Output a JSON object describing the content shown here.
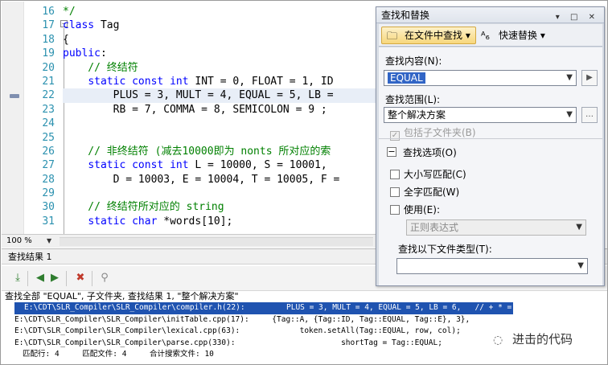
{
  "editor": {
    "zoom": "100 %",
    "lines": [
      {
        "n": "16",
        "parts": [
          {
            "t": "*/",
            "c": "cm"
          }
        ]
      },
      {
        "n": "17",
        "parts": [
          {
            "t": "class",
            "c": "kw"
          },
          {
            "t": " Tag",
            "c": ""
          }
        ]
      },
      {
        "n": "18",
        "parts": [
          {
            "t": "{",
            "c": ""
          }
        ]
      },
      {
        "n": "19",
        "parts": [
          {
            "t": "public",
            "c": "kw"
          },
          {
            "t": ":",
            "c": ""
          }
        ]
      },
      {
        "n": "20",
        "parts": [
          {
            "t": "    // 终结符",
            "c": "cm"
          }
        ]
      },
      {
        "n": "21",
        "parts": [
          {
            "t": "    ",
            "c": ""
          },
          {
            "t": "static",
            "c": "kw"
          },
          {
            "t": " ",
            "c": ""
          },
          {
            "t": "const",
            "c": "kw"
          },
          {
            "t": " ",
            "c": ""
          },
          {
            "t": "int",
            "c": "kw"
          },
          {
            "t": " INT = 0, FLOAT = 1, ID",
            "c": ""
          }
        ]
      },
      {
        "n": "22",
        "hl": true,
        "parts": [
          {
            "t": "        PLUS = 3, MULT = 4, EQUAL = 5, LB = ",
            "c": ""
          }
        ]
      },
      {
        "n": "23",
        "parts": [
          {
            "t": "        RB = 7, COMMA = 8, SEMICOLON = 9 ;",
            "c": ""
          }
        ]
      },
      {
        "n": "24",
        "parts": [
          {
            "t": "",
            "c": ""
          }
        ]
      },
      {
        "n": "25",
        "parts": [
          {
            "t": "",
            "c": ""
          }
        ]
      },
      {
        "n": "26",
        "parts": [
          {
            "t": "    // 非终结符 (减去10000即为 nonts 所对应的索",
            "c": "cm"
          }
        ]
      },
      {
        "n": "27",
        "parts": [
          {
            "t": "    ",
            "c": ""
          },
          {
            "t": "static",
            "c": "kw"
          },
          {
            "t": " ",
            "c": ""
          },
          {
            "t": "const",
            "c": "kw"
          },
          {
            "t": " ",
            "c": ""
          },
          {
            "t": "int",
            "c": "kw"
          },
          {
            "t": " L = 10000, S = 10001, ",
            "c": ""
          }
        ]
      },
      {
        "n": "28",
        "parts": [
          {
            "t": "        D = 10003, E = 10004, T = 10005, F =",
            "c": ""
          }
        ]
      },
      {
        "n": "29",
        "parts": [
          {
            "t": "",
            "c": ""
          }
        ]
      },
      {
        "n": "30",
        "parts": [
          {
            "t": "    // 终结符所对应的 string",
            "c": "cm"
          }
        ]
      },
      {
        "n": "31",
        "parts": [
          {
            "t": "    ",
            "c": ""
          },
          {
            "t": "static",
            "c": "kw"
          },
          {
            "t": " ",
            "c": ""
          },
          {
            "t": "char",
            "c": "kw"
          },
          {
            "t": " *words[10];",
            "c": ""
          }
        ]
      }
    ]
  },
  "results": {
    "title": "查找结果 1",
    "header": "查找全部 \"EQUAL\", 子文件夹, 查找结果 1, \"整个解决方案\"",
    "rows": [
      {
        "text": "E:\\CDT\\SLR_Compiler\\SLR_Compiler\\compiler.h(22):         PLUS = 3, MULT = 4, EQUAL = 5, LB = 6,   // + * =",
        "selected": true
      },
      {
        "text": "E:\\CDT\\SLR_Compiler\\SLR_Compiler\\initTable.cpp(17):     {Tag::A, {Tag::ID, Tag::EQUAL, Tag::E}, 3},",
        "selected": false
      },
      {
        "text": "E:\\CDT\\SLR_Compiler\\SLR_Compiler\\lexical.cpp(63):             token.setAll(Tag::EQUAL, row, col);",
        "selected": false
      },
      {
        "text": "E:\\CDT\\SLR_Compiler\\SLR_Compiler\\parse.cpp(330):                       shortTag = Tag::EQUAL;",
        "selected": false
      }
    ],
    "summary": "匹配行: 4     匹配文件: 4     合计搜索文件: 10"
  },
  "dialog": {
    "title": "查找和替换",
    "tab_find": "在文件中查找",
    "tab_replace": "快速替换",
    "find_label": "查找内容(N):",
    "find_value": "EQUAL",
    "scope_label": "查找范围(L):",
    "scope_value": "整个解决方案",
    "include_sub": "包括子文件夹(B)",
    "options_label": "查找选项(O)",
    "match_case": "大小写匹配(C)",
    "whole_word": "全字匹配(W)",
    "use": "使用(E):",
    "regex": "正则表达式",
    "filetypes_label": "查找以下文件类型(T):",
    "filetypes_value": ""
  },
  "watermark": "进击的代码",
  "icons": [
    "find-next-result-icon",
    "prev-result-icon",
    "next-result-icon",
    "clear-results-icon",
    "stop-search-icon",
    "find-in-files-icon",
    "quick-replace-icon",
    "wechat-icon"
  ]
}
